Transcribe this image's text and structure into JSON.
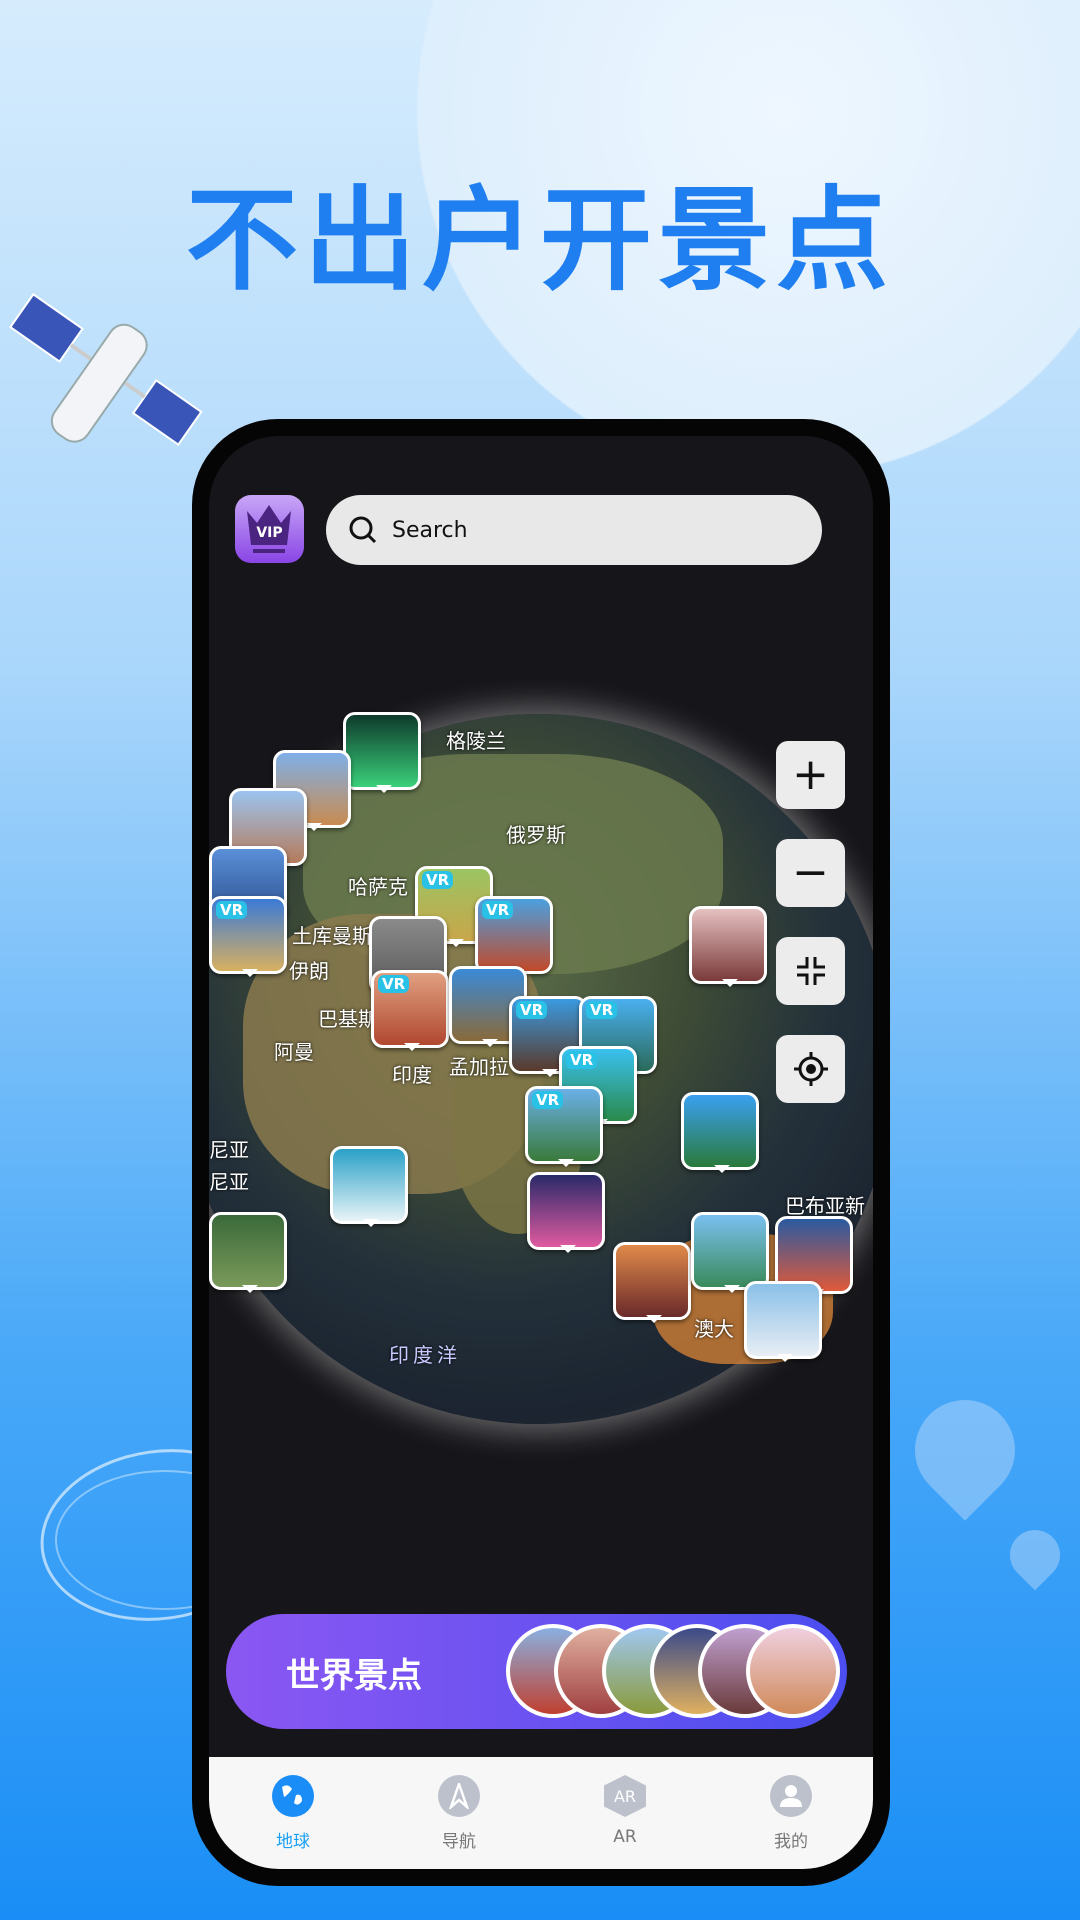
{
  "headline": "不出户开景点",
  "header": {
    "vip_label": "VIP",
    "search_placeholder": "Search"
  },
  "map": {
    "labels": [
      "格陵兰",
      "俄罗斯",
      "哈萨克",
      "土库曼斯",
      "伊朗",
      "巴基斯",
      "阿曼",
      "印度",
      "孟加拉",
      "尼亚",
      "尼亚",
      "巴布亚新",
      "澳大",
      "印度洋"
    ],
    "vr_badge": "VR"
  },
  "controls": {
    "zoom_in": "+",
    "zoom_out": "−"
  },
  "banner": {
    "title": "世界景点"
  },
  "tabs": [
    {
      "label": "地球",
      "active": true
    },
    {
      "label": "导航"
    },
    {
      "label": "AR",
      "icon_text": "AR"
    },
    {
      "label": "我的"
    }
  ],
  "colors": {
    "accent": "#1f7ff0",
    "tab_active": "#1aa0f5"
  }
}
